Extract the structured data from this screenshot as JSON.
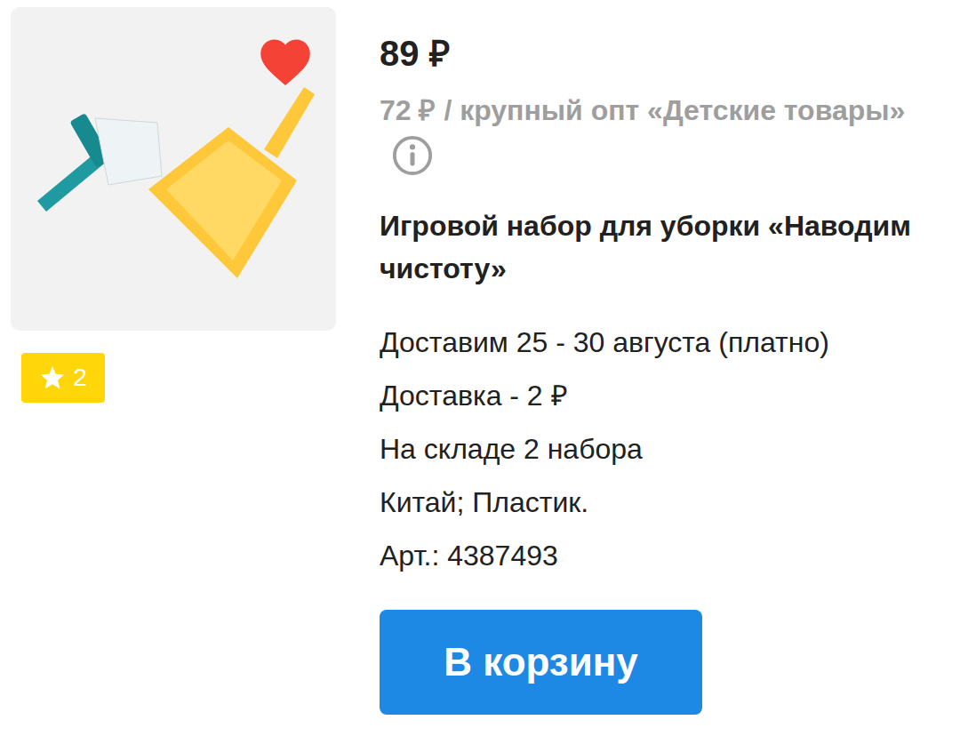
{
  "product": {
    "favorite": true,
    "rating": "2",
    "price": "89 ₽",
    "wholesale": "72 ₽ / крупный опт «Детские товары»",
    "title": "Игровой набор для уборки «Наводим чистоту»",
    "details": [
      "Доставим 25 - 30 августа (платно)",
      "Доставка - 2 ₽",
      "На складе 2 набора",
      "Китай; Пластик.",
      "Арт.: 4387493"
    ],
    "button": "В корзину"
  }
}
